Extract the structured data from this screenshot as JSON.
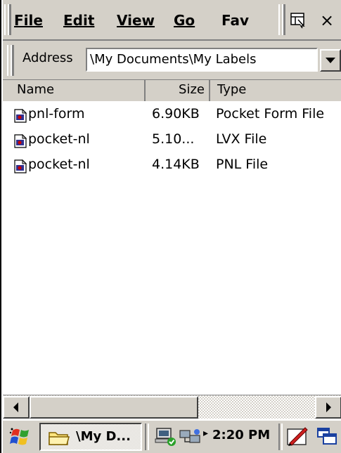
{
  "menu": {
    "file": "File",
    "edit": "Edit",
    "view": "View",
    "go": "Go",
    "favorites": "Fav",
    "close": "×"
  },
  "address": {
    "label": "Address",
    "value": "\\My Documents\\My Labels"
  },
  "columns": {
    "name": "Name",
    "size": "Size",
    "type": "Type"
  },
  "files": [
    {
      "name": "pnl-form",
      "size": "6.90KB",
      "type": "Pocket Form File"
    },
    {
      "name": "pocket-nl",
      "size": "5.10...",
      "type": "LVX File"
    },
    {
      "name": "pocket-nl",
      "size": "4.14KB",
      "type": "PNL File"
    }
  ],
  "taskbar": {
    "window_label": "\\My D...",
    "clock": "2:20 PM"
  },
  "colors": {
    "chrome": "#d4d0c8",
    "shadow": "#808080",
    "text": "#000000"
  }
}
